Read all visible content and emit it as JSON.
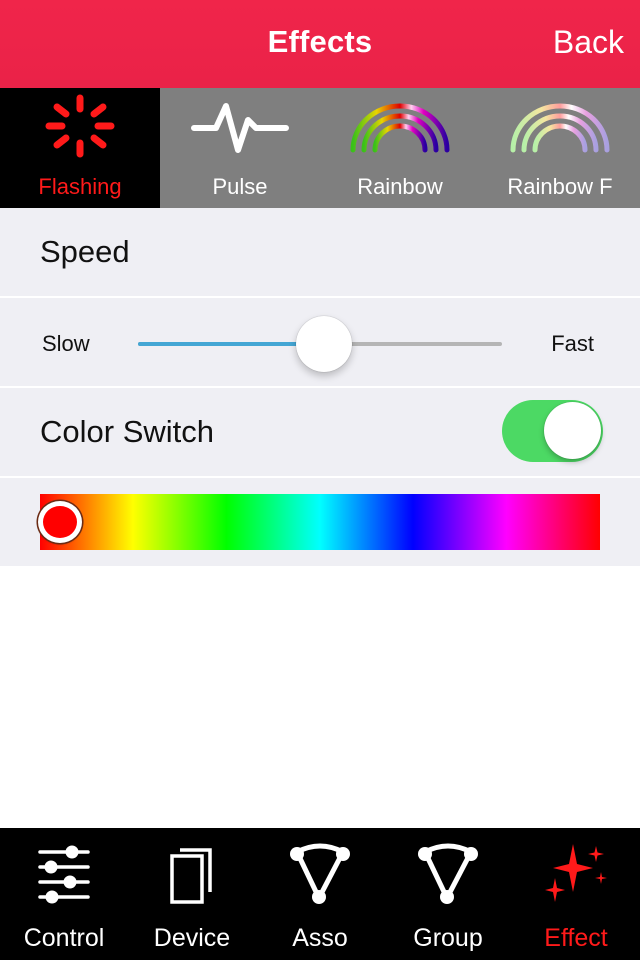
{
  "navbar": {
    "title": "Effects",
    "back_label": "Back",
    "color": "#ee2449"
  },
  "effects": [
    {
      "label": "Flashing",
      "icon": "flashing-spinner-icon",
      "active": true
    },
    {
      "label": "Pulse",
      "icon": "pulse-wave-icon",
      "active": false
    },
    {
      "label": "Rainbow",
      "icon": "rainbow-icon",
      "active": false
    },
    {
      "label": "Rainbow F",
      "icon": "rainbow-fade-icon",
      "active": false
    }
  ],
  "speed": {
    "title": "Speed",
    "min_label": "Slow",
    "max_label": "Fast",
    "value": 0.51
  },
  "color_switch": {
    "label": "Color Switch",
    "on": true,
    "on_color": "#4cd964"
  },
  "color_picker": {
    "hue_degrees": 0,
    "selected_color": "#ff0000"
  },
  "tabbar": {
    "items": [
      {
        "label": "Control",
        "icon": "sliders-icon",
        "active": false
      },
      {
        "label": "Device",
        "icon": "devices-icon",
        "active": false
      },
      {
        "label": "Asso",
        "icon": "association-icon",
        "active": false
      },
      {
        "label": "Group",
        "icon": "group-icon",
        "active": false
      },
      {
        "label": "Effect",
        "icon": "sparkles-icon",
        "active": true
      }
    ],
    "active_color": "#ff1a1a"
  }
}
